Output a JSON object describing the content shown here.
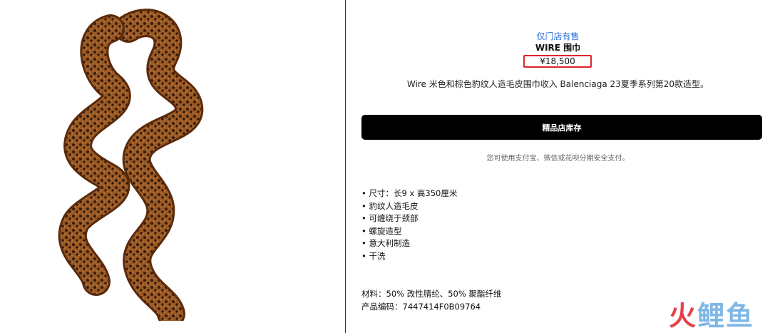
{
  "product": {
    "availability": "仅门店有售",
    "title": "WIRE 围巾",
    "price": "¥18,500",
    "description": "Wire 米色和棕色豹纹人造毛皮围巾收入 Balenciaga 23夏季系列第20款造型。",
    "stock_button_label": "精品店库存",
    "payment_note": "您可使用支付宝、微信或花呗分期安全支付。",
    "features": [
      "尺寸：长9 x 高350厘米",
      "豹纹人造毛皮",
      "可缠绕于颈部",
      "螺旋造型",
      "意大利制造",
      "干洗"
    ],
    "material": "材料：50% 改性腈纶、50% 聚酯纤维",
    "product_code": "产品编码：7447414F0B09764"
  },
  "watermark": {
    "char_1": "火",
    "char_2": "鲤",
    "char_3": "鱼"
  },
  "colors": {
    "price_highlight": "#d9262c",
    "availability_link": "#2b6fd6",
    "button_bg": "#000000",
    "fur_brown": "#8a4a1c"
  },
  "image": {
    "icon": "leopard-fur-spiral-scarf-image"
  }
}
